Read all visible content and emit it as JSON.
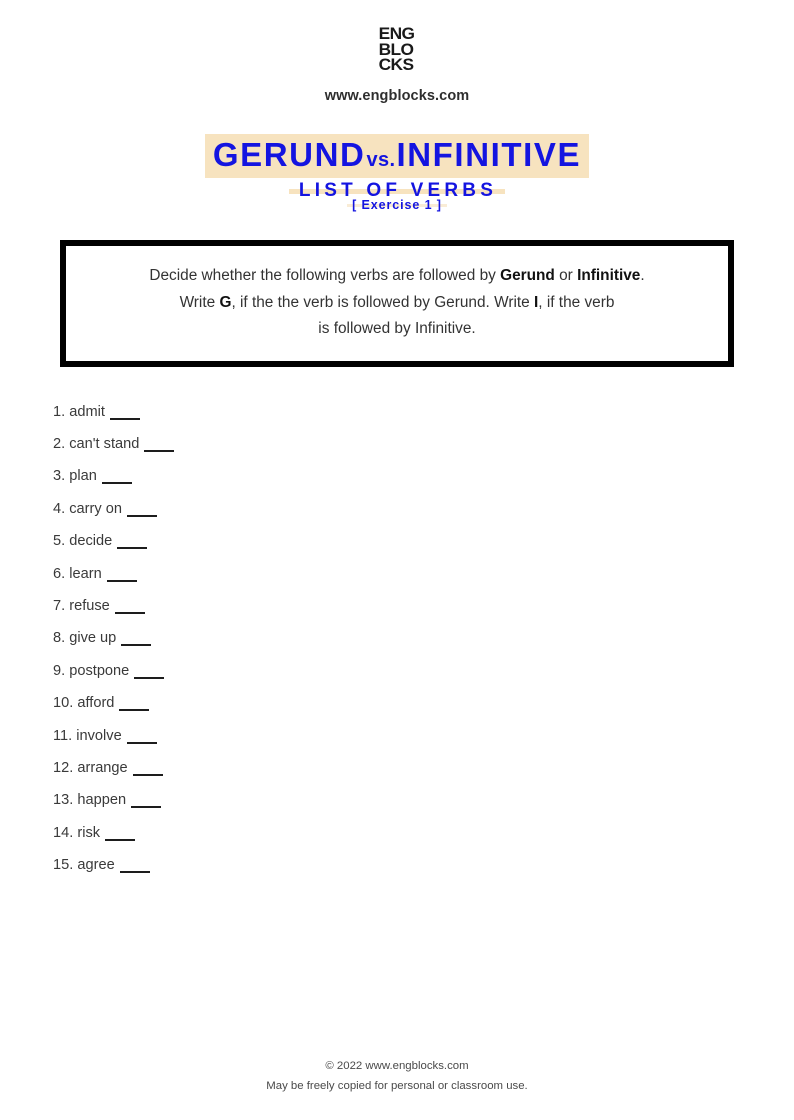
{
  "header": {
    "logo_lines": [
      "ENG",
      "BLO",
      "CKS"
    ],
    "site_url": "www.engblocks.com"
  },
  "title": {
    "main_left": "GERUND",
    "main_vs": "vs.",
    "main_right": "INFINITIVE",
    "subtitle": "LIST OF VERBS",
    "exercise": "[ Exercise 1 ]",
    "highlight_color": "#f7e3bf",
    "text_color": "#1414e0"
  },
  "instructions": {
    "line1_a": "Decide whether the following verbs are followed by ",
    "line1_bold1": "Gerund",
    "line1_b": " or ",
    "line1_bold2": "Infinitive",
    "line1_c": ".",
    "line2_a": "Write ",
    "line2_bold1": "G",
    "line2_b": ", if the the verb is followed by Gerund. Write ",
    "line2_bold2": "I",
    "line2_c": ", if the verb",
    "line3": "is followed by Infinitive."
  },
  "exercise": {
    "items": [
      {
        "number": "1.",
        "verb": "admit"
      },
      {
        "number": "2.",
        "verb": "can't stand"
      },
      {
        "number": "3.",
        "verb": "plan"
      },
      {
        "number": "4.",
        "verb": "carry on"
      },
      {
        "number": "5.",
        "verb": "decide"
      },
      {
        "number": "6.",
        "verb": "learn"
      },
      {
        "number": "7.",
        "verb": "refuse"
      },
      {
        "number": "8.",
        "verb": "give up"
      },
      {
        "number": "9.",
        "verb": "postpone"
      },
      {
        "number": "10.",
        "verb": "afford"
      },
      {
        "number": "11.",
        "verb": "involve"
      },
      {
        "number": "12.",
        "verb": "arrange"
      },
      {
        "number": "13.",
        "verb": "happen"
      },
      {
        "number": "14.",
        "verb": "risk"
      },
      {
        "number": "15.",
        "verb": "agree"
      }
    ]
  },
  "footer": {
    "copyright": "© 2022 www.engblocks.com",
    "note": "May be freely copied for personal or classroom use."
  }
}
